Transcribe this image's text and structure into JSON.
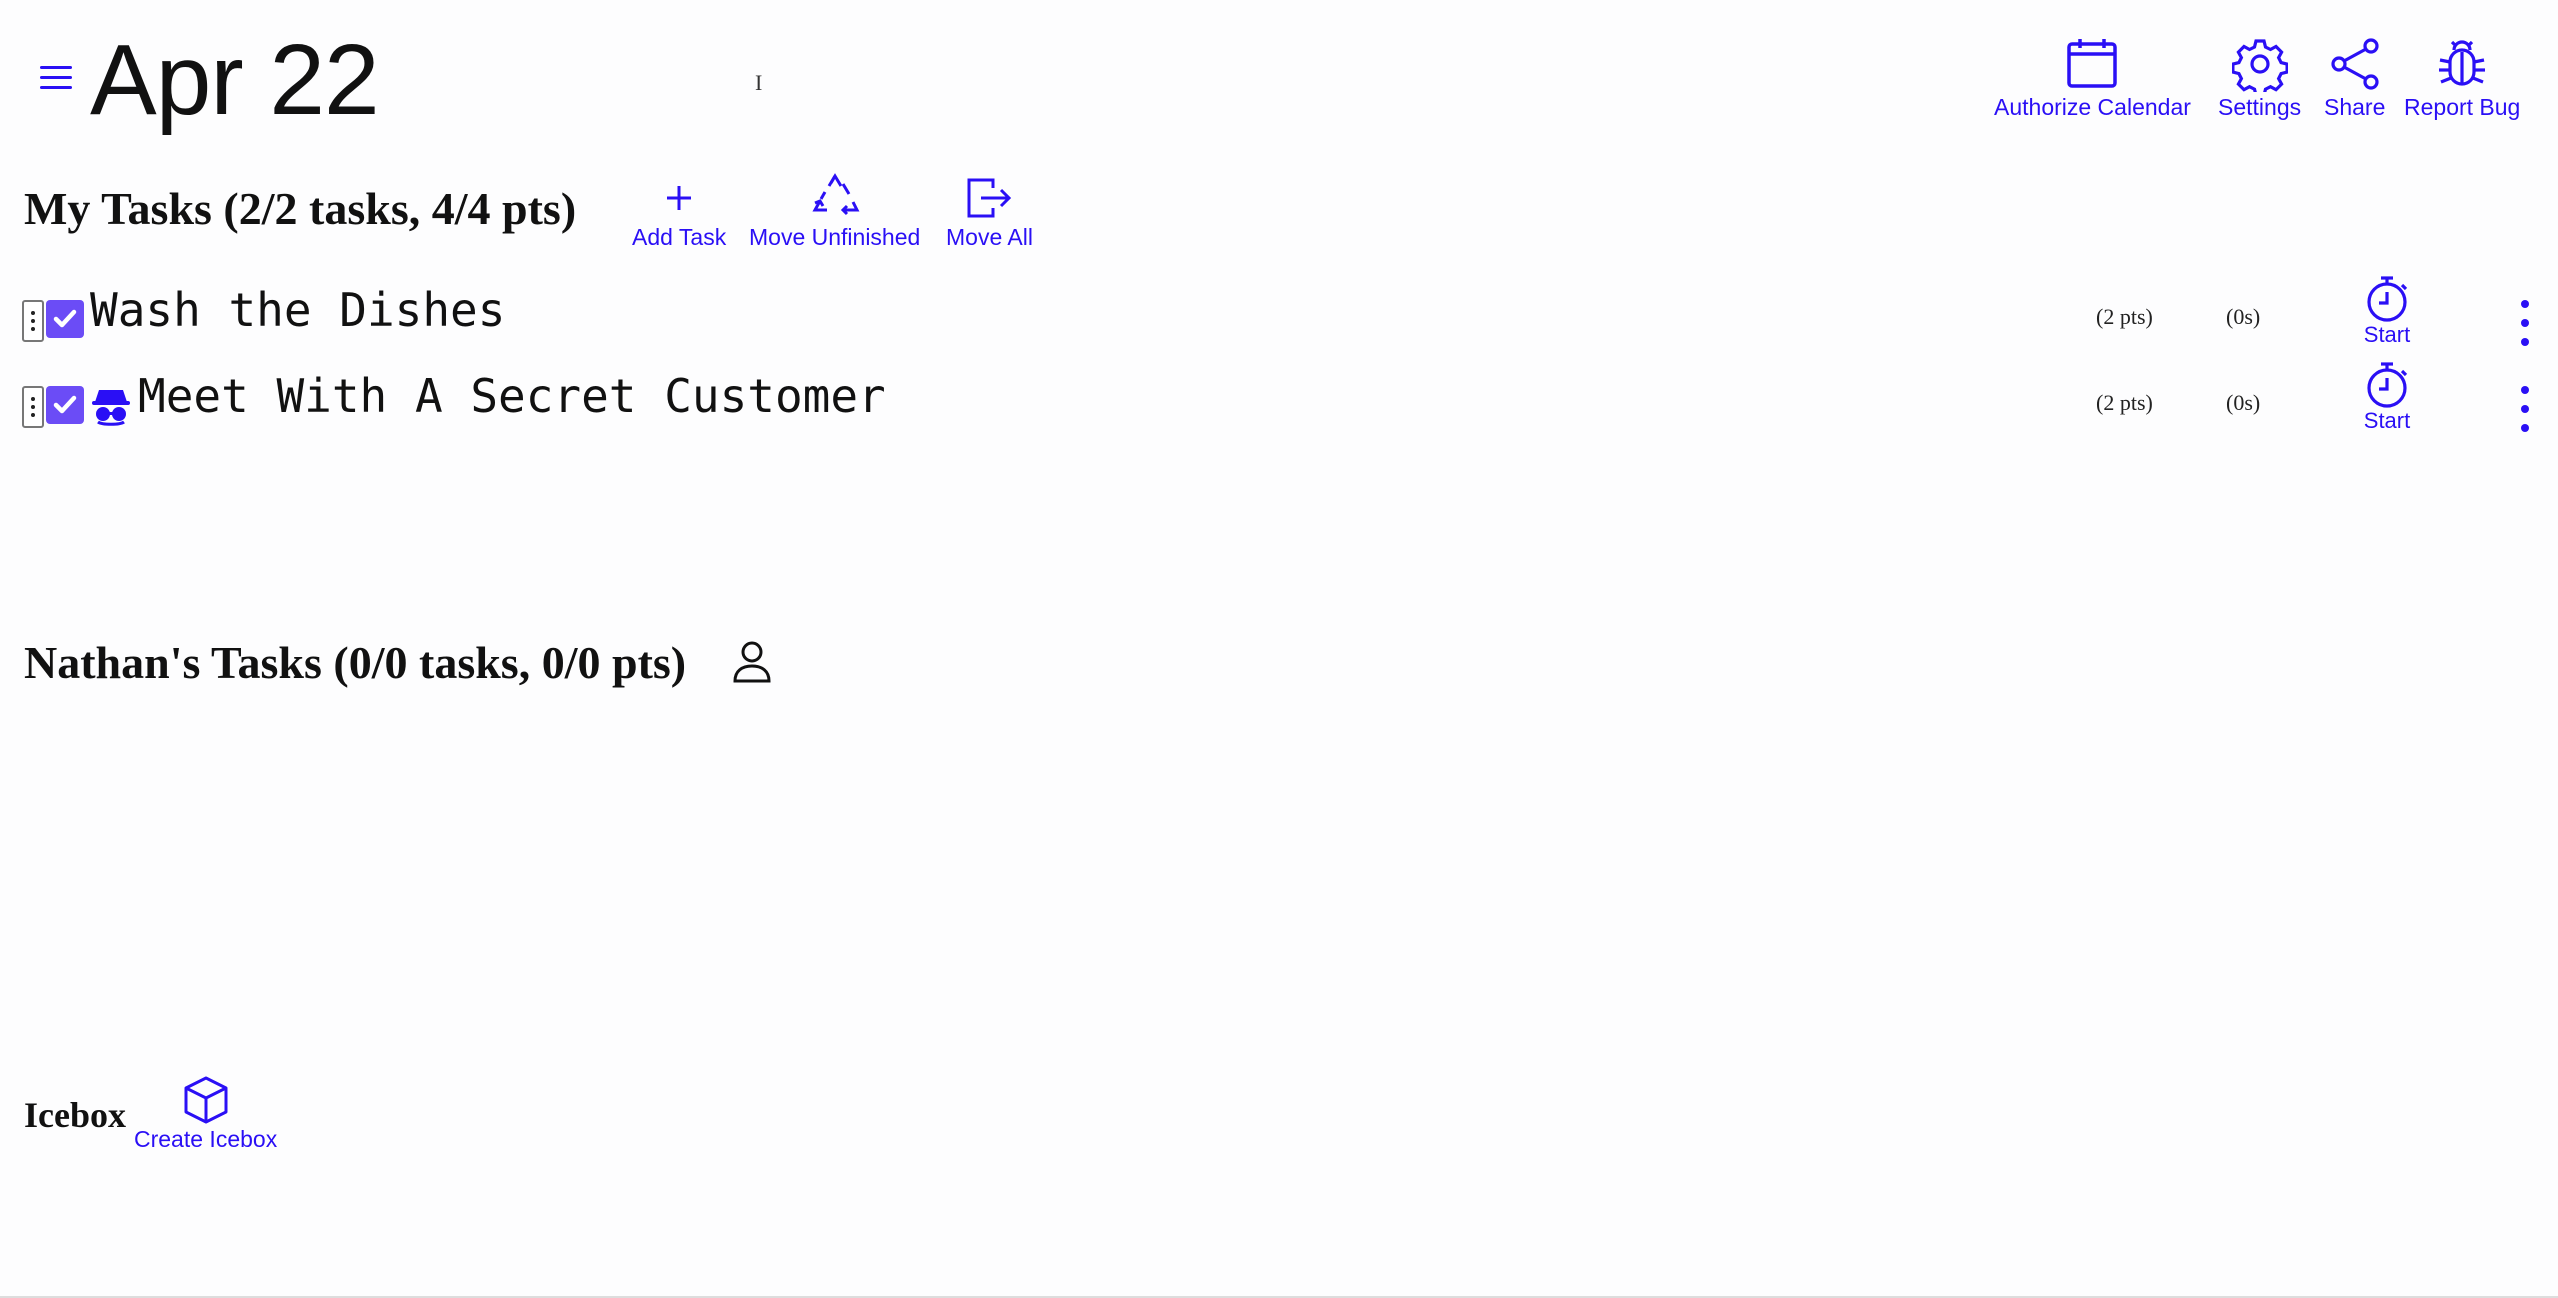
{
  "header": {
    "date": "Apr 22",
    "menu_icon": "hamburger-menu-icon",
    "actions": [
      {
        "label": "Authorize Calendar",
        "icon": "calendar-icon"
      },
      {
        "label": "Settings",
        "icon": "gear-icon"
      },
      {
        "label": "Share",
        "icon": "share-icon"
      },
      {
        "label": "Report Bug",
        "icon": "bug-icon"
      }
    ]
  },
  "my_tasks": {
    "heading": "My Tasks (2/2 tasks, 4/4 pts)",
    "actions": [
      {
        "label": "Add Task",
        "icon": "plus-icon"
      },
      {
        "label": "Move Unfinished",
        "icon": "recycle-icon"
      },
      {
        "label": "Move All",
        "icon": "move-out-icon"
      }
    ],
    "tasks": [
      {
        "title": "Wash the Dishes",
        "points": "(2 pts)",
        "time": "(0s)",
        "start_label": "Start",
        "completed": true,
        "icon": null
      },
      {
        "title": "Meet With A Secret Customer",
        "points": "(2 pts)",
        "time": "(0s)",
        "start_label": "Start",
        "completed": true,
        "icon": "spy-icon"
      }
    ]
  },
  "nathans_tasks": {
    "heading": "Nathan's Tasks (0/0 tasks, 0/0 pts)",
    "icon": "person-icon"
  },
  "icebox": {
    "heading": "Icebox",
    "action_label": "Create Icebox",
    "action_icon": "box-icon"
  },
  "colors": {
    "accent": "#2a0ff5",
    "checkbox": "#6b4cf6",
    "background": "#fdfdfe"
  }
}
